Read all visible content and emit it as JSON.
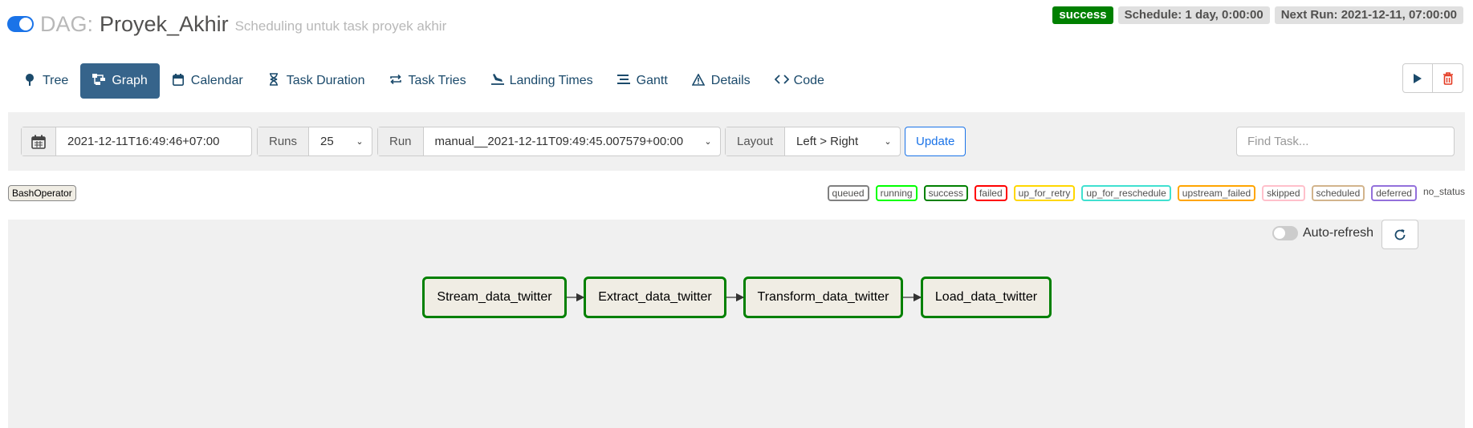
{
  "header": {
    "dag_prefix": "DAG:",
    "dag_id": "Proyek_Akhir",
    "description": "Scheduling untuk task proyek akhir",
    "state_badge": "success",
    "schedule": "Schedule: 1 day, 0:00:00",
    "next_run": "Next Run: 2021-12-11, 07:00:00"
  },
  "nav": {
    "items": [
      {
        "label": "Tree",
        "icon": "tree-icon"
      },
      {
        "label": "Graph",
        "icon": "graph-icon"
      },
      {
        "label": "Calendar",
        "icon": "calendar-icon"
      },
      {
        "label": "Task Duration",
        "icon": "hourglass-icon"
      },
      {
        "label": "Task Tries",
        "icon": "repeat-icon"
      },
      {
        "label": "Landing Times",
        "icon": "landing-icon"
      },
      {
        "label": "Gantt",
        "icon": "gantt-icon"
      },
      {
        "label": "Details",
        "icon": "warning-triangle-icon"
      },
      {
        "label": "Code",
        "icon": "code-icon"
      }
    ],
    "active": "Graph"
  },
  "controls": {
    "base_date": "2021-12-11T16:49:46+07:00",
    "runs_label": "Runs",
    "runs_value": "25",
    "run_label": "Run",
    "run_value": "manual__2021-12-11T09:49:45.007579+00:00",
    "layout_label": "Layout",
    "layout_value": "Left > Right",
    "update_label": "Update",
    "find_task_placeholder": "Find Task..."
  },
  "operator_tag": "BashOperator",
  "legend": [
    {
      "label": "queued",
      "color": "#808080"
    },
    {
      "label": "running",
      "color": "#00ff00"
    },
    {
      "label": "success",
      "color": "#008000"
    },
    {
      "label": "failed",
      "color": "#ff0000"
    },
    {
      "label": "up_for_retry",
      "color": "#ffd700"
    },
    {
      "label": "up_for_reschedule",
      "color": "#40e0d0"
    },
    {
      "label": "upstream_failed",
      "color": "#ffa500"
    },
    {
      "label": "skipped",
      "color": "#ffc0cb"
    },
    {
      "label": "scheduled",
      "color": "#d2b48c"
    },
    {
      "label": "deferred",
      "color": "#9370db"
    },
    {
      "label": "no_status",
      "color": ""
    }
  ],
  "graph": {
    "auto_refresh_label": "Auto-refresh",
    "tasks": [
      "Stream_data_twitter",
      "Extract_data_twitter",
      "Transform_data_twitter",
      "Load_data_twitter"
    ],
    "status_color": "#008000"
  },
  "colors": {
    "accent": "#1a73e8",
    "nav_active": "#36648b",
    "nav_text": "#1b4a6b",
    "success": "#008000"
  }
}
